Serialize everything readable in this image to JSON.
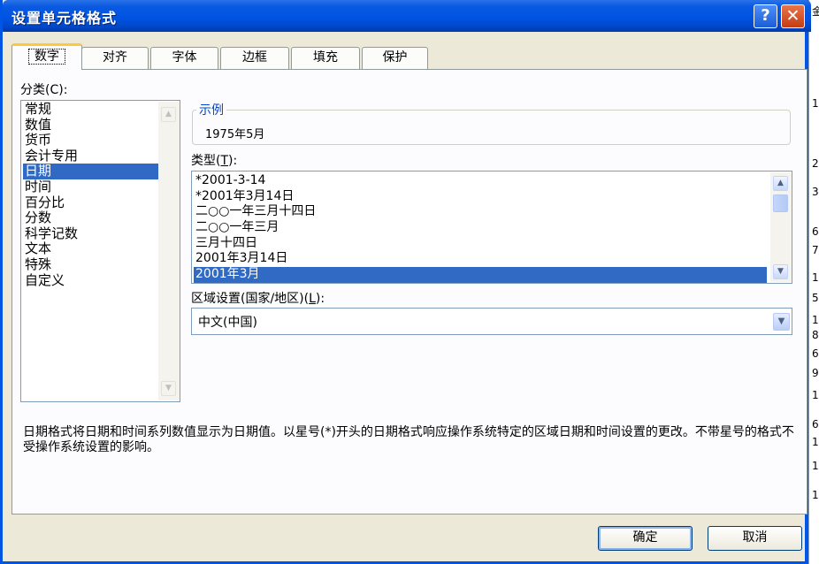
{
  "window": {
    "title": "设置单元格格式",
    "help_glyph": "?",
    "close_glyph": "✕"
  },
  "tabs": [
    {
      "label": "数字",
      "active": true
    },
    {
      "label": "对齐",
      "active": false
    },
    {
      "label": "字体",
      "active": false
    },
    {
      "label": "边框",
      "active": false
    },
    {
      "label": "填充",
      "active": false
    },
    {
      "label": "保护",
      "active": false
    }
  ],
  "category": {
    "label": "分类",
    "hotkey": "(C):",
    "hotkey_letter": "C",
    "items": [
      "常规",
      "数值",
      "货币",
      "会计专用",
      "日期",
      "时间",
      "百分比",
      "分数",
      "科学记数",
      "文本",
      "特殊",
      "自定义"
    ],
    "selected": "日期"
  },
  "sample": {
    "title": "示例",
    "value": "1975年5月"
  },
  "type": {
    "label": "类型",
    "hotkey_letter": "T",
    "items": [
      "*2001-3-14",
      "*2001年3月14日",
      "二○○一年三月十四日",
      "二○○一年三月",
      "三月十四日",
      "2001年3月14日",
      "2001年3月"
    ],
    "selected": "2001年3月"
  },
  "locale": {
    "label": "区域设置(国家/地区)",
    "hotkey_letter": "L",
    "value": "中文(中国)"
  },
  "description": "日期格式将日期和时间系列数值显示为日期值。以星号(*)开头的日期格式响应操作系统特定的区域日期和时间设置的更改。不带星号的格式不受操作系统设置的影响。",
  "buttons": {
    "ok": "确定",
    "cancel": "取消"
  },
  "background_sheet": {
    "visible_glyphs": [
      "金",
      "1",
      "2",
      "3",
      "6",
      "7",
      "1",
      "5",
      "1",
      "8",
      "6",
      "9",
      "1",
      "6",
      "1",
      "1",
      "1"
    ]
  },
  "colors": {
    "titlebar": "#0054e3",
    "selection": "#316ac5",
    "dialog_face": "#ece9d8",
    "sample_title": "#0046d5",
    "active_tab_accent": "#ffc83c"
  }
}
